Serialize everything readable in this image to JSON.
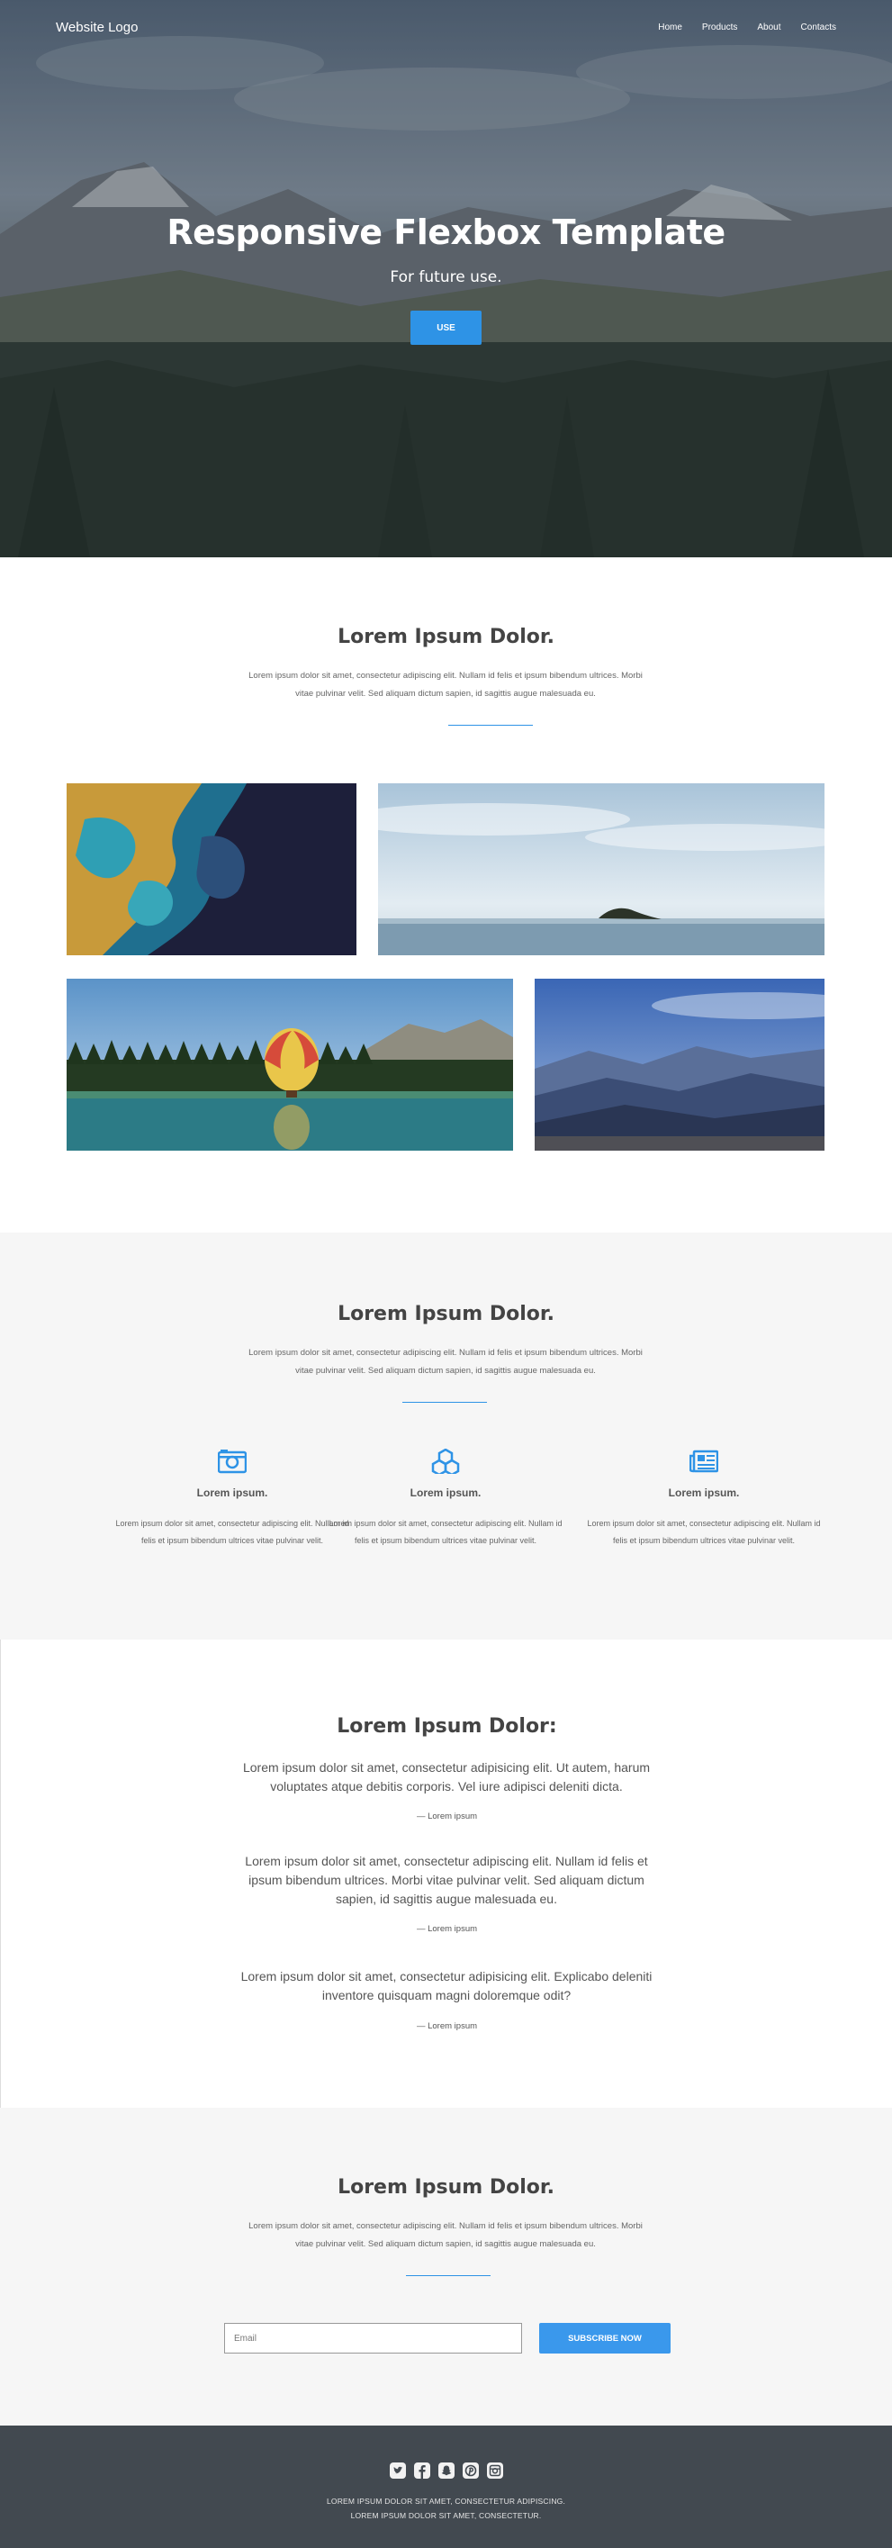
{
  "header": {
    "logo": "Website Logo",
    "nav": [
      "Home",
      "Products",
      "About",
      "Contacts"
    ]
  },
  "hero": {
    "title": "Responsive Flexbox Template",
    "subtitle": "For future use.",
    "button": "USE"
  },
  "gallery_section": {
    "title": "Lorem Ipsum Dolor.",
    "text": "Lorem ipsum dolor sit amet, consectetur adipiscing elit. Nullam id felis et ipsum bibendum ultrices. Morbi vitae pulvinar velit. Sed aliquam dictum sapien, id sagittis augue malesuada eu."
  },
  "features_section": {
    "title": "Lorem Ipsum Dolor.",
    "text": "Lorem ipsum dolor sit amet, consectetur adipiscing elit. Nullam id felis et ipsum bibendum ultrices. Morbi vitae pulvinar velit. Sed aliquam dictum sapien, id sagittis augue malesuada eu.",
    "items": [
      {
        "icon": "camera-icon",
        "title": "Lorem ipsum.",
        "text": "Lorem ipsum dolor sit amet, consectetur adipiscing elit. Nullam id felis et ipsum bibendum ultrices vitae pulvinar velit."
      },
      {
        "icon": "cubes-icon",
        "title": "Lorem ipsum.",
        "text": "Lorem ipsum dolor sit amet, consectetur adipiscing elit. Nullam id felis et ipsum bibendum ultrices vitae pulvinar velit."
      },
      {
        "icon": "newspaper-icon",
        "title": "Lorem ipsum.",
        "text": "Lorem ipsum dolor sit amet, consectetur adipiscing elit. Nullam id felis et ipsum bibendum ultrices vitae pulvinar velit."
      }
    ]
  },
  "testimonials_section": {
    "title": "Lorem Ipsum Dolor:",
    "quotes": [
      {
        "text": "Lorem ipsum dolor sit amet, consectetur adipisicing elit. Ut autem, harum voluptates atque debitis corporis. Vel iure adipisci deleniti dicta.",
        "author": "— Lorem ipsum"
      },
      {
        "text": "Lorem ipsum dolor sit amet, consectetur adipiscing elit. Nullam id felis et ipsum bibendum ultrices. Morbi vitae pulvinar velit. Sed aliquam dictum sapien, id sagittis augue malesuada eu.",
        "author": "— Lorem ipsum"
      },
      {
        "text": "Lorem ipsum dolor sit amet, consectetur adipisicing elit. Explicabo deleniti inventore quisquam magni doloremque odit?",
        "author": "— Lorem ipsum"
      }
    ]
  },
  "subscribe_section": {
    "title": "Lorem Ipsum Dolor.",
    "text": "Lorem ipsum dolor sit amet, consectetur adipiscing elit. Nullam id felis et ipsum bibendum ultrices. Morbi vitae pulvinar velit. Sed aliquam dictum sapien, id sagittis augue malesuada eu.",
    "email_placeholder": "Email",
    "button": "SUBSCRIBE NOW"
  },
  "footer": {
    "social_icons": [
      "twitter-icon",
      "facebook-icon",
      "snapchat-icon",
      "pinterest-icon",
      "instagram-icon"
    ],
    "line1": "LOREM IPSUM DOLOR SIT AMET, CONSECTETUR ADIPISCING.",
    "line2": "LOREM IPSUM DOLOR SIT AMET, CONSECTETUR."
  },
  "colors": {
    "accent": "#2e93e6",
    "footer_bg": "#424950",
    "alt_section_bg": "#f6f6f6"
  }
}
